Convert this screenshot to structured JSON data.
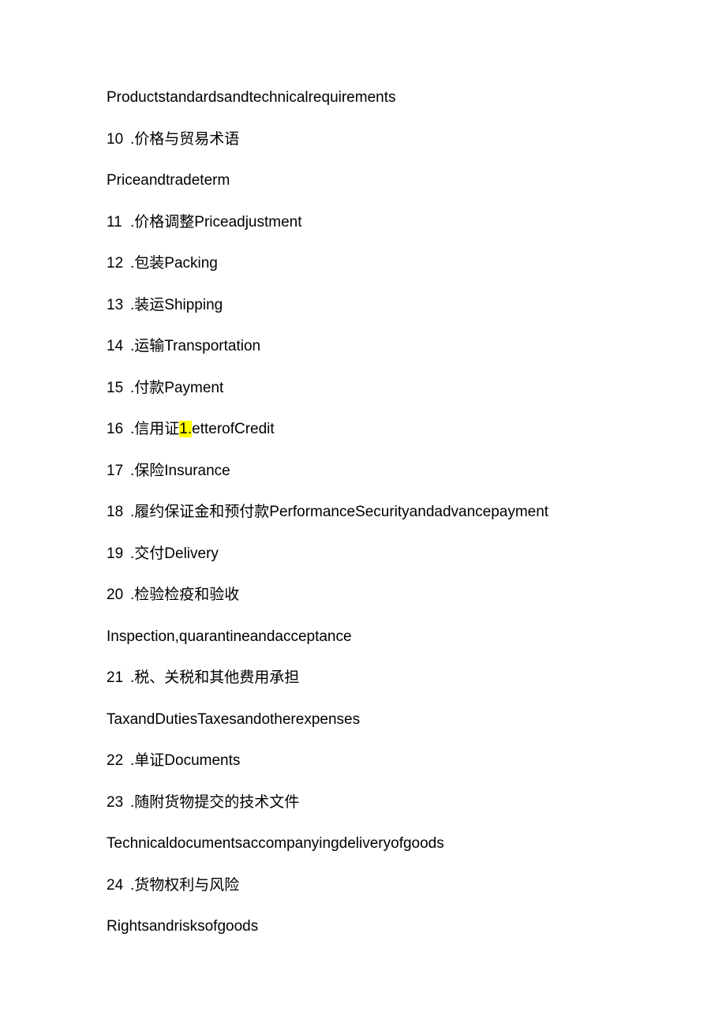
{
  "lines": {
    "l0": "Productstandardsandtechnicalrequirements",
    "l1_num": "10",
    "l1_text": ".价格与贸易术语",
    "l2": "Priceandtradeterm",
    "l3_num": "11",
    "l3_text": ".价格调整Priceadjustment",
    "l4_num": "12",
    "l4_text": ".包装Packing",
    "l5_num": "13",
    "l5_text": ".装运Shipping",
    "l6_num": "14",
    "l6_text": ".运输Transportation",
    "l7_num": "15",
    "l7_text": ".付款Payment",
    "l8_num": "16",
    "l8_pre": ".信用证",
    "l8_hl": "1.",
    "l8_post": "etterofCredit",
    "l9_num": "17",
    "l9_text": ".保险Insurance",
    "l10_num": "18",
    "l10_text": ".履约保证金和预付款PerformanceSecurityandadvancepayment",
    "l11_num": "19",
    "l11_text": ".交付Delivery",
    "l12_num": "20",
    "l12_text": ".检验检疫和验收",
    "l13": "Inspection,quarantineandacceptance",
    "l14_num": "21",
    "l14_text": ".税、关税和其他费用承担",
    "l15": "TaxandDutiesTaxesandotherexpenses",
    "l16_num": "22",
    "l16_text": ".单证Documents",
    "l17_num": "23",
    "l17_text": ".随附货物提交的技术文件",
    "l18": "Technicaldocumentsaccompanyingdeliveryofgoods",
    "l19_num": "24",
    "l19_text": ".货物权利与风险",
    "l20": "Rightsandrisksofgoods"
  }
}
